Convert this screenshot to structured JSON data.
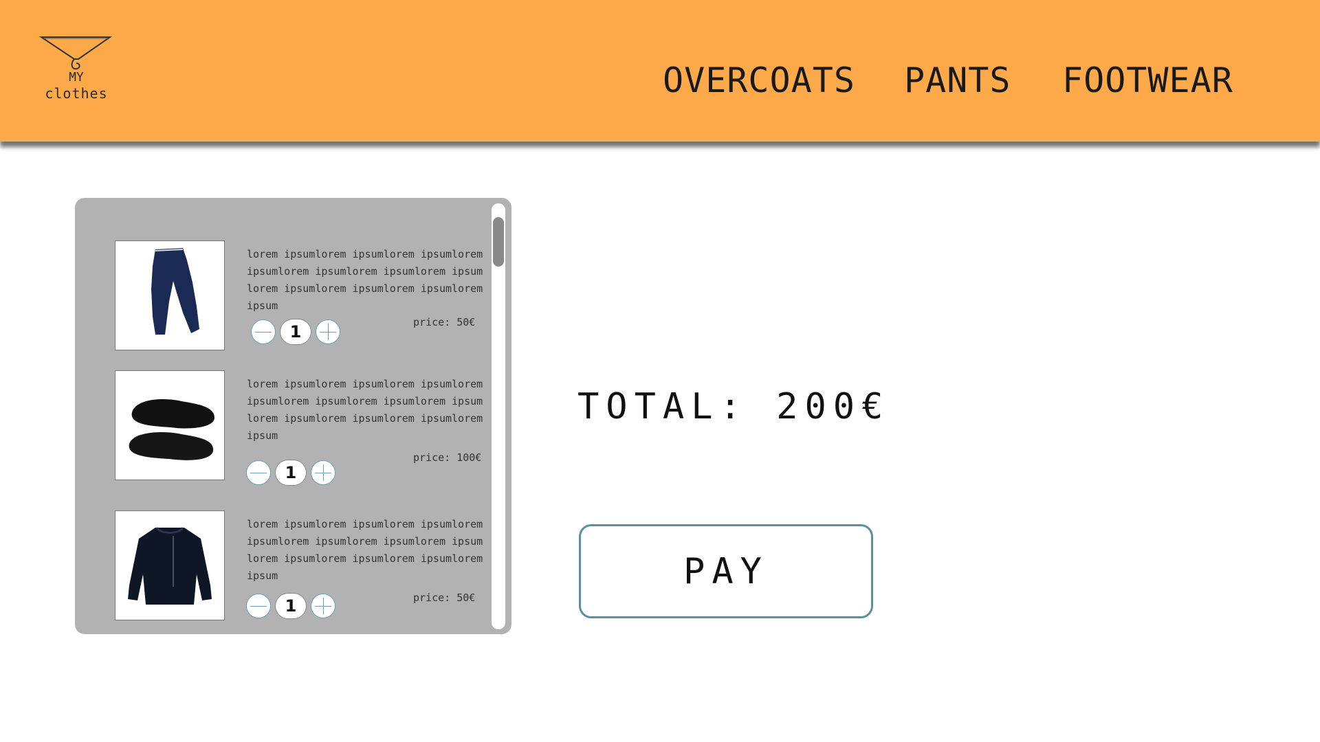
{
  "header": {
    "logo": {
      "line1": "MY",
      "line2": "clothes"
    },
    "nav": [
      {
        "label": "OVERCOATS"
      },
      {
        "label": "PANTS"
      },
      {
        "label": "FOOTWEAR"
      }
    ]
  },
  "cart": {
    "items": [
      {
        "image": "jeans",
        "description": "lorem ipsumlorem ipsumlorem ipsumlorem ipsumlorem ipsumlorem ipsumlorem ipsumlorem ipsumlorem ipsumlorem ipsumlorem ipsum",
        "price": "price: 50€",
        "quantity": "1"
      },
      {
        "image": "boots",
        "description": "lorem ipsumlorem ipsumlorem ipsumlorem ipsumlorem ipsumlorem ipsumlorem ipsumlorem ipsumlorem ipsumlorem ipsumlorem ipsum",
        "price": "price: 100€",
        "quantity": "1"
      },
      {
        "image": "jacket",
        "description": "lorem ipsumlorem ipsumlorem ipsumlorem ipsumlorem ipsumlorem ipsumlorem ipsumlorem ipsumlorem ipsumlorem ipsumlorem ipsum",
        "price": "price: 50€",
        "quantity": "1"
      }
    ]
  },
  "summary": {
    "total": "TOTAL: 200€",
    "pay_label": "PAY"
  },
  "colors": {
    "header_bg": "#ffaa4a",
    "panel_bg": "#b2b2b2",
    "accent_border": "#5b8fa4"
  }
}
